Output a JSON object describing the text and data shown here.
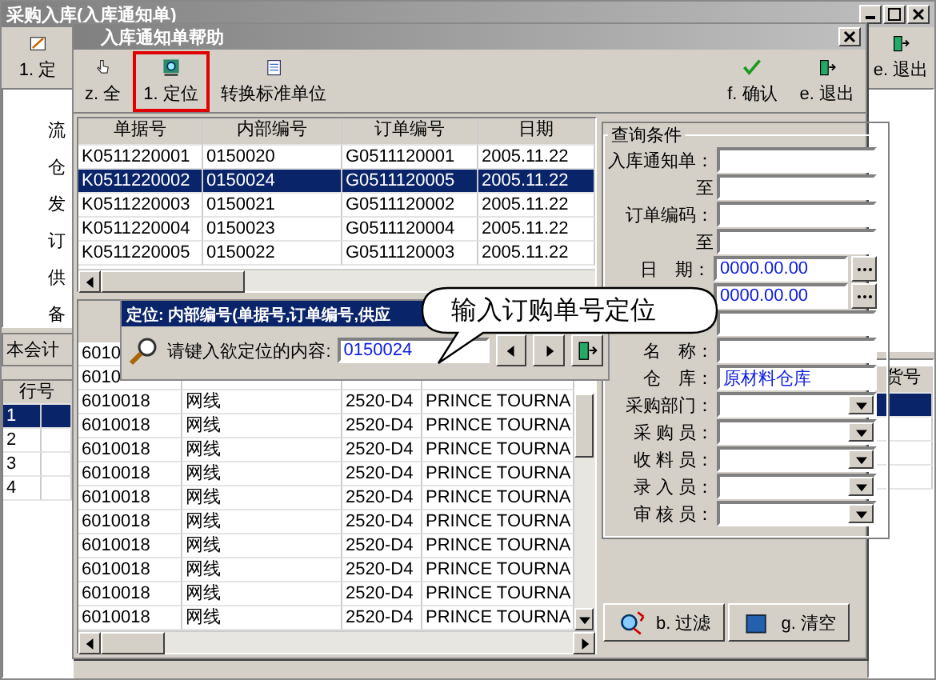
{
  "main_window": {
    "title": "采购入库(入库通知单)",
    "toolbar": [
      {
        "label": "1. 定",
        "kind": "customize"
      },
      {
        "label": "e. 退出",
        "kind": "exit"
      }
    ],
    "form_labels": [
      "流",
      "仓",
      "发",
      "订",
      "供",
      "备"
    ],
    "tab": "本会计",
    "line_grid": {
      "columns": [
        "行号",
        "货号"
      ],
      "rows": [
        {
          "number": "1",
          "selected": true
        },
        {
          "number": "2",
          "selected": false
        },
        {
          "number": "3",
          "selected": false
        },
        {
          "number": "4",
          "selected": false
        }
      ]
    }
  },
  "dialog": {
    "title": "入库通知单帮助",
    "toolbar_left": [
      {
        "label": "z. 全",
        "kind": "select",
        "highlighted": false
      },
      {
        "label": "1. 定位",
        "kind": "locate",
        "highlighted": true
      },
      {
        "label": "转换标准单位",
        "kind": "convert",
        "highlighted": false
      }
    ],
    "toolbar_right": [
      {
        "label": "f. 确认",
        "kind": "confirm"
      },
      {
        "label": "e. 退出",
        "kind": "exit"
      }
    ],
    "notice_grid": {
      "columns": [
        "单据号",
        "内部编号",
        "订单编号",
        "日期"
      ],
      "rows": [
        {
          "cells": [
            "K0511220001",
            "0150020",
            "G0511120001",
            "2005.11.22"
          ],
          "selected": false
        },
        {
          "cells": [
            "K0511220002",
            "0150024",
            "G0511120005",
            "2005.11.22"
          ],
          "selected": true
        },
        {
          "cells": [
            "K0511220003",
            "0150021",
            "G0511120002",
            "2005.11.22"
          ],
          "selected": false
        },
        {
          "cells": [
            "K0511220004",
            "0150023",
            "G0511120004",
            "2005.11.22"
          ],
          "selected": false
        },
        {
          "cells": [
            "K0511220005",
            "0150022",
            "G0511120003",
            "2005.11.22"
          ],
          "selected": false
        }
      ]
    },
    "detail_grid": {
      "rows": [
        {
          "cells": [
            "6010"
          ]
        },
        {
          "cells": [
            "6010"
          ]
        },
        {
          "cells": [
            "6010018",
            "网线",
            "2520-D4",
            "PRINCE TOURNA"
          ]
        },
        {
          "cells": [
            "6010018",
            "网线",
            "2520-D4",
            "PRINCE TOURNA"
          ]
        },
        {
          "cells": [
            "6010018",
            "网线",
            "2520-D4",
            "PRINCE TOURNA"
          ]
        },
        {
          "cells": [
            "6010018",
            "网线",
            "2520-D4",
            "PRINCE TOURNA"
          ]
        },
        {
          "cells": [
            "6010018",
            "网线",
            "2520-D4",
            "PRINCE TOURNA"
          ]
        },
        {
          "cells": [
            "6010018",
            "网线",
            "2520-D4",
            "PRINCE TOURNA"
          ]
        },
        {
          "cells": [
            "6010018",
            "网线",
            "2520-D4",
            "PRINCE TOURNA"
          ]
        },
        {
          "cells": [
            "6010018",
            "网线",
            "2520-D4",
            "PRINCE TOURNA"
          ]
        },
        {
          "cells": [
            "6010018",
            "网线",
            "2520-D4",
            "PRINCE TOURNA"
          ]
        },
        {
          "cells": [
            "6010018",
            "网线",
            "2520-D4",
            "PRINCE TOURNA"
          ]
        }
      ]
    },
    "query": {
      "title": "查询条件",
      "fields": [
        {
          "kind": "text",
          "label": "入库通知单："
        },
        {
          "kind": "text",
          "label": "至"
        },
        {
          "kind": "text",
          "label": "订单编码："
        },
        {
          "kind": "text",
          "label": "至"
        },
        {
          "kind": "date",
          "label": "日　期：",
          "value": "0000.00.00"
        },
        {
          "kind": "date",
          "value": "0000.00.00"
        },
        {
          "kind": "text"
        },
        {
          "kind": "text",
          "label": "名　称："
        },
        {
          "kind": "text",
          "label": "仓　库：",
          "value": "原材料仓库"
        },
        {
          "kind": "dropdown",
          "label": "采购部门："
        },
        {
          "kind": "dropdown",
          "label": "采 购 员："
        },
        {
          "kind": "dropdown",
          "label": "收 料 员："
        },
        {
          "kind": "dropdown",
          "label": "录 入 员："
        },
        {
          "kind": "dropdown",
          "label": "审 核 员："
        }
      ]
    },
    "buttons": [
      {
        "label": "b. 过滤",
        "kind": "filter"
      },
      {
        "label": "g. 清空",
        "kind": "clear"
      }
    ]
  },
  "locate_bar": {
    "title": "定位: 内部编号(单据号,订单编号,供应",
    "prompt": "请键入欲定位的内容:",
    "value": "0150024"
  },
  "callout": "输入订购单号定位"
}
